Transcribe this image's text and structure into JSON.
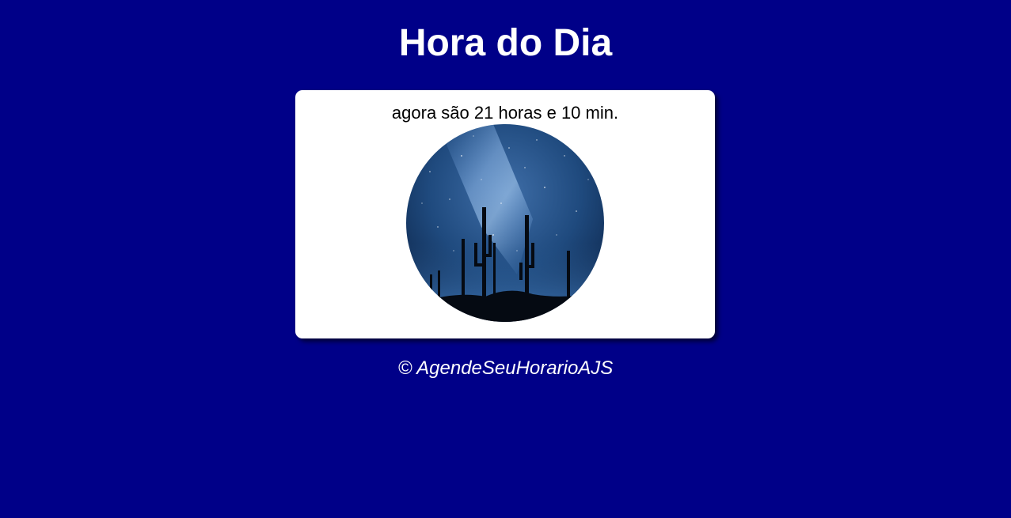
{
  "header": {
    "title": "Hora do Dia"
  },
  "card": {
    "time_text": "agora são 21 horas e 10 min.",
    "image": {
      "name": "night-sky-cactus-photo"
    }
  },
  "footer": {
    "text": "© AgendeSeuHorarioAJS"
  },
  "colors": {
    "background": "#000088",
    "card": "#ffffff",
    "title_text": "#ffffff",
    "body_text": "#000000"
  }
}
